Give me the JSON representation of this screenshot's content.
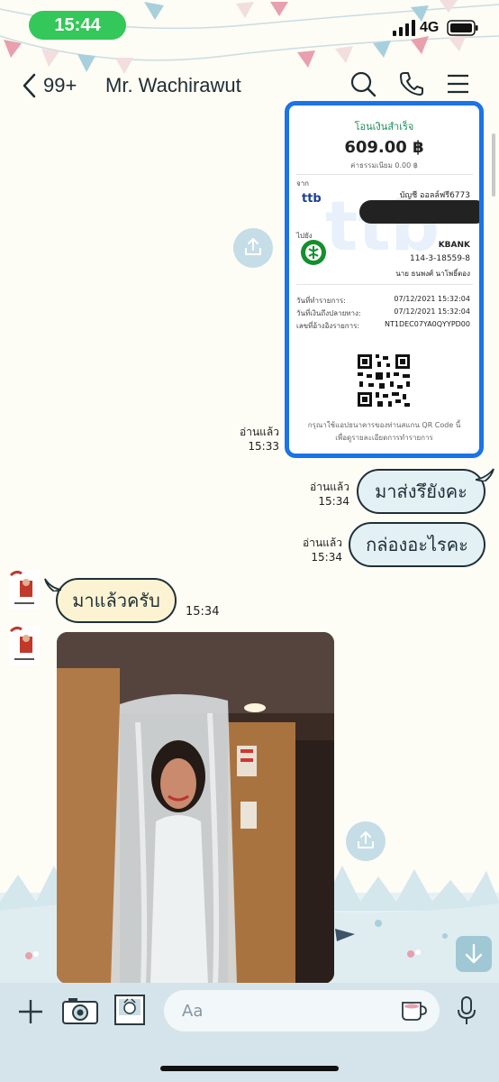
{
  "status_bar": {
    "time": "15:44",
    "network": "4G"
  },
  "header": {
    "unread_count": "99+",
    "chat_name": "Mr. Wachirawut",
    "icons": [
      "back-chevron-icon",
      "search-icon",
      "phone-icon",
      "menu-icon"
    ]
  },
  "receipt": {
    "title": "โอนเงินสำเร็จ",
    "amount": "609.00 ฿",
    "fee": "ค่าธรรมเนียม 0.00 ฿",
    "from_label": "จาก",
    "from_account": "บัญชี ออลล์ฟรี6773",
    "from_bank_logo": "ttb",
    "to_label": "ไปยัง",
    "to_bank": "KBANK",
    "to_account": "114-3-18559-8",
    "to_name": "นาย ธนพงศ์ นาโพธิ์ตอง",
    "rows": [
      {
        "label": "วันที่ทำรายการ:",
        "value": "07/12/2021 15:32:04"
      },
      {
        "label": "วันที่เงินถึงปลายทาง:",
        "value": "07/12/2021 15:32:04"
      },
      {
        "label": "เลขที่อ้างอิงรายการ:",
        "value": "NT1DEC07YA0QYYPD00"
      }
    ],
    "qr_note_1": "กรุณาใช้แอปธนาคารของท่านสแกน QR Code นี้",
    "qr_note_2": "เพื่อดูรายละเอียดการทำรายการ"
  },
  "messages": {
    "receipt_read": "อ่านแล้ว",
    "receipt_time": "15:33",
    "out1_read": "อ่านแล้ว",
    "out1_time": "15:34",
    "out1_text": "มาส่งรึยังคะ",
    "out2_read": "อ่านแล้ว",
    "out2_time": "15:34",
    "out2_text": "กล่องอะไรคะ",
    "in1_text": "มาแล้วครับ",
    "in1_time": "15:34"
  },
  "input": {
    "placeholder": "Aa",
    "icons": [
      "plus-icon",
      "camera-icon",
      "photo-icon",
      "sticker-icon",
      "mic-icon"
    ]
  },
  "colors": {
    "time_pill": "#34c759",
    "receipt_border": "#1a73e8",
    "out_bubble": "#e4f1f4",
    "in_bubble": "#fbf3d2",
    "input_bar": "#d4e4ea"
  }
}
